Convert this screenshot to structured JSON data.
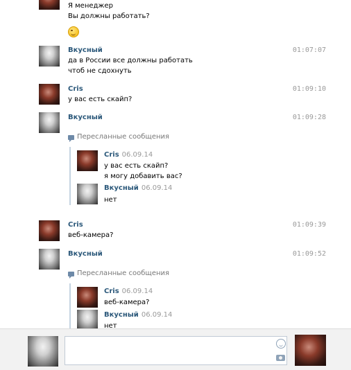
{
  "messages": [
    {
      "lines": [
        "Я менеджер",
        "Вы должны работать?"
      ]
    },
    {
      "author": "Вкусный",
      "time": "01:07:07",
      "lines": [
        "да в России все должны работать",
        "чтоб не сдохнуть"
      ]
    },
    {
      "author": "Cris",
      "time": "01:09:10",
      "lines": [
        "у вас есть скайп?"
      ]
    },
    {
      "author": "Вкусный",
      "time": "01:09:28",
      "forwarded_label": "Пересланные сообщения",
      "forwarded": [
        {
          "author": "Cris",
          "date": "06.09.14",
          "lines": [
            "у вас есть скайп?",
            "я могу добавить вас?"
          ]
        },
        {
          "author": "Вкусный",
          "date": "06.09.14",
          "lines": [
            "нет"
          ]
        }
      ]
    },
    {
      "author": "Cris",
      "time": "01:09:39",
      "lines": [
        "веб-камера?"
      ]
    },
    {
      "author": "Вкусный",
      "time": "01:09:52",
      "forwarded_label": "Пересланные сообщения",
      "forwarded": [
        {
          "author": "Cris",
          "date": "06.09.14",
          "lines": [
            "веб-камера?"
          ]
        },
        {
          "author": "Вкусный",
          "date": "06.09.14",
          "lines": [
            "нет"
          ]
        }
      ]
    }
  ],
  "composer": {
    "placeholder": ""
  }
}
